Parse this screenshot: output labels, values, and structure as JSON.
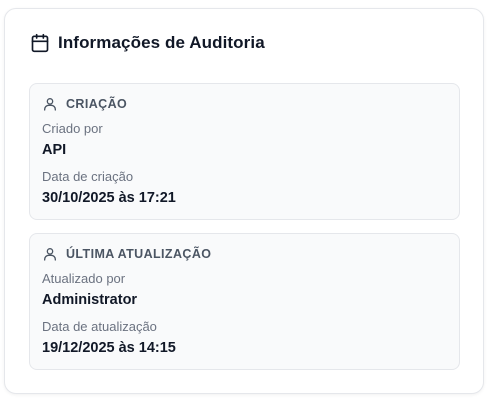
{
  "card": {
    "title": "Informações de Auditoria",
    "title_icon": "calendar-icon"
  },
  "created": {
    "heading": "CRIAÇÃO",
    "heading_icon": "user-icon",
    "created_by_label": "Criado por",
    "created_by_value": "API",
    "date_label": "Data de criação",
    "date_value": "30/10/2025 às 17:21"
  },
  "updated": {
    "heading": "ÚLTIMA ATUALIZAÇÃO",
    "heading_icon": "user-icon",
    "updated_by_label": "Atualizado por",
    "updated_by_value": "Administrator",
    "date_label": "Data de atualização",
    "date_value": "19/12/2025 às 14:15"
  },
  "colors": {
    "card_border": "#e5e7eb",
    "section_bg": "#f9fafb",
    "muted_text": "#6b7280",
    "strong_text": "#111827"
  }
}
